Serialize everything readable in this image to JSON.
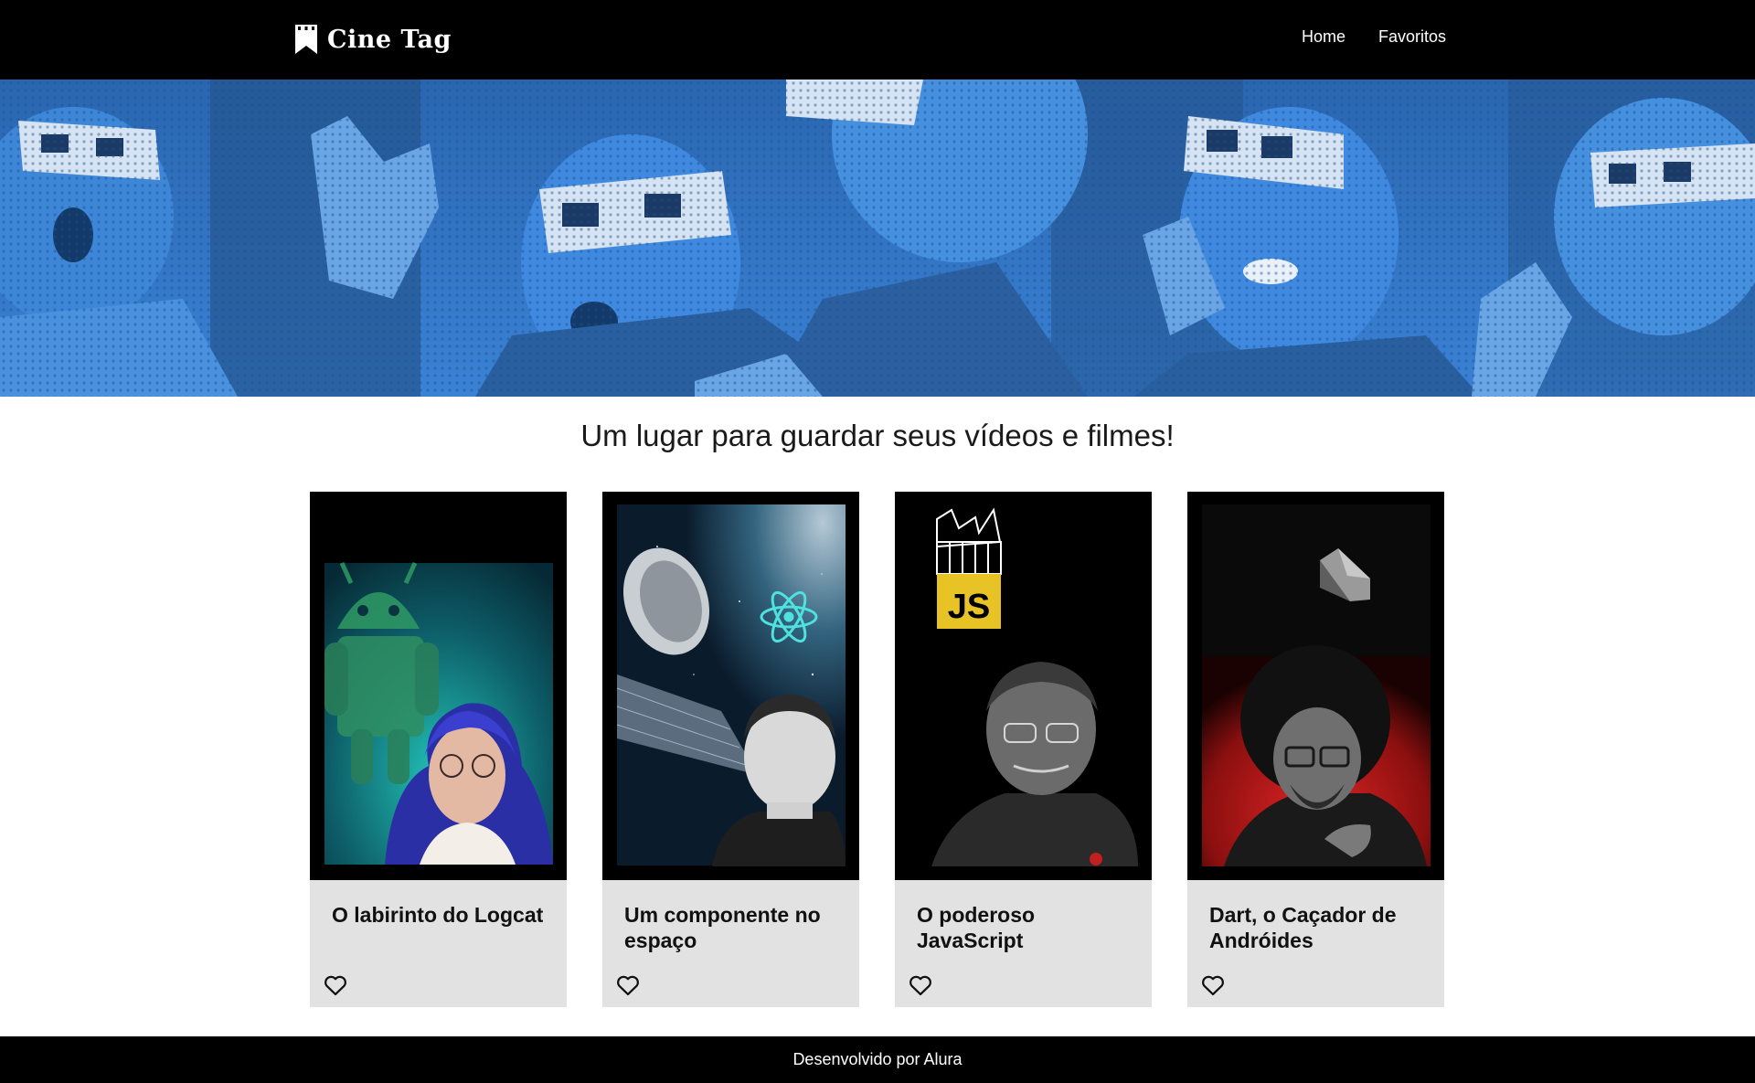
{
  "header": {
    "logo_text": "Cine Tag",
    "nav": [
      {
        "label": "Home"
      },
      {
        "label": "Favoritos"
      }
    ]
  },
  "banner": {
    "description_icon": "banner-image"
  },
  "main": {
    "headline": "Um lugar para guardar seus vídeos e filmes!",
    "cards": [
      {
        "title": "O labirinto do Logcat",
        "favorite": false
      },
      {
        "title": "Um componente no espaço",
        "favorite": false
      },
      {
        "title": "O poderoso JavaScript",
        "favorite": false
      },
      {
        "title": "Dart, o Caçador de Andróides",
        "favorite": false
      }
    ],
    "poster_badges": {
      "js_label": "JS"
    }
  },
  "footer": {
    "text": "Desenvolvido por Alura"
  },
  "colors": {
    "header_bg": "#000000",
    "banner_blue": "#2f74c6",
    "card_body_bg": "#e2e2e2",
    "js_yellow": "#e8c325",
    "footer_bg": "#000000"
  }
}
